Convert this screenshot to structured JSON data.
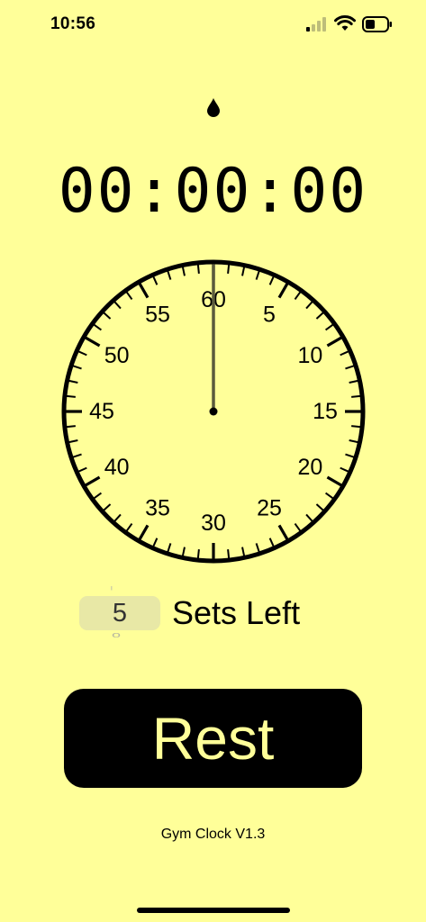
{
  "status_bar": {
    "time": "10:56"
  },
  "timer": {
    "elapsed": "00:00:00"
  },
  "dial": {
    "labels": [
      "60",
      "5",
      "10",
      "15",
      "20",
      "25",
      "30",
      "35",
      "40",
      "45",
      "50",
      "55"
    ],
    "hand_seconds": 0,
    "colors": {
      "face": "#ffff99",
      "ink": "#000000",
      "hand": "#5a5a3c"
    }
  },
  "sets": {
    "value": "5",
    "label": "Sets Left"
  },
  "rest_button": {
    "label": "Rest"
  },
  "footer": {
    "version": "Gym Clock V1.3"
  },
  "theme": {
    "background": "#ffff99",
    "button_bg": "#000000",
    "button_text": "#ffff99",
    "picker_bg": "#e8e8a6"
  }
}
